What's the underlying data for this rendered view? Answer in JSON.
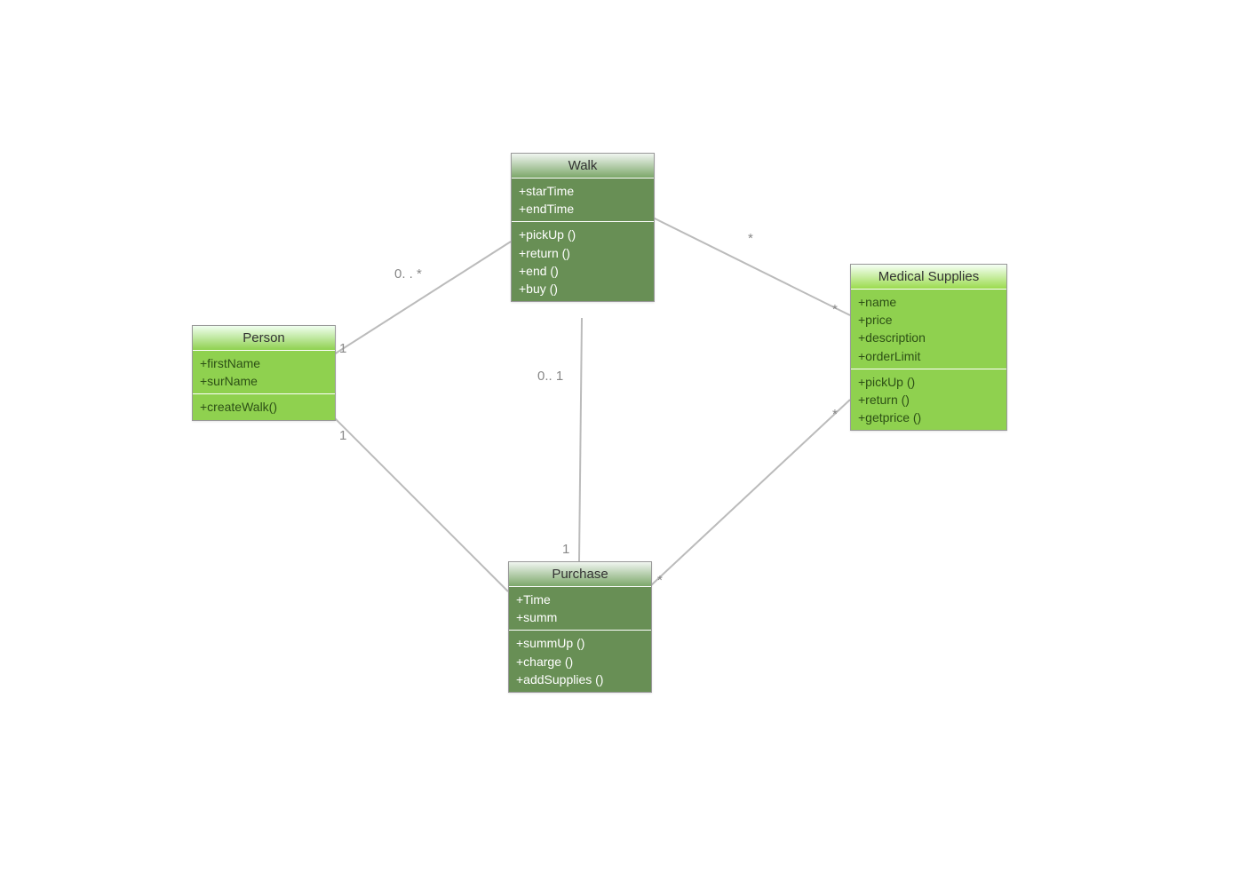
{
  "classes": {
    "person": {
      "name": "Person",
      "attributes": [
        "+firstName",
        "+surName"
      ],
      "methods": [
        "+createWalk()"
      ]
    },
    "walk": {
      "name": "Walk",
      "attributes": [
        "+starTime",
        "+endTime"
      ],
      "methods": [
        "+pickUp ()",
        "+return ()",
        "+end ()",
        "+buy ()"
      ]
    },
    "medical": {
      "name": "Medical Supplies",
      "attributes": [
        "+name",
        "+price",
        "+description",
        "+orderLimit"
      ],
      "methods": [
        "+pickUp ()",
        "+return ()",
        "+getprice ()"
      ]
    },
    "purchase": {
      "name": "Purchase",
      "attributes": [
        "+Time",
        "+summ"
      ],
      "methods": [
        "+summUp ()",
        "+charge ()",
        "+addSupplies ()"
      ]
    }
  },
  "multiplicities": {
    "person_walk_person": "1",
    "person_walk_walk": "0. . *",
    "person_purchase_person": "1",
    "walk_medical_walk": "*",
    "walk_medical_medical": "*",
    "walk_purchase_walk": "0.. 1",
    "walk_purchase_purchase": "1",
    "purchase_medical_purchase": "*",
    "purchase_medical_medical": "*"
  }
}
